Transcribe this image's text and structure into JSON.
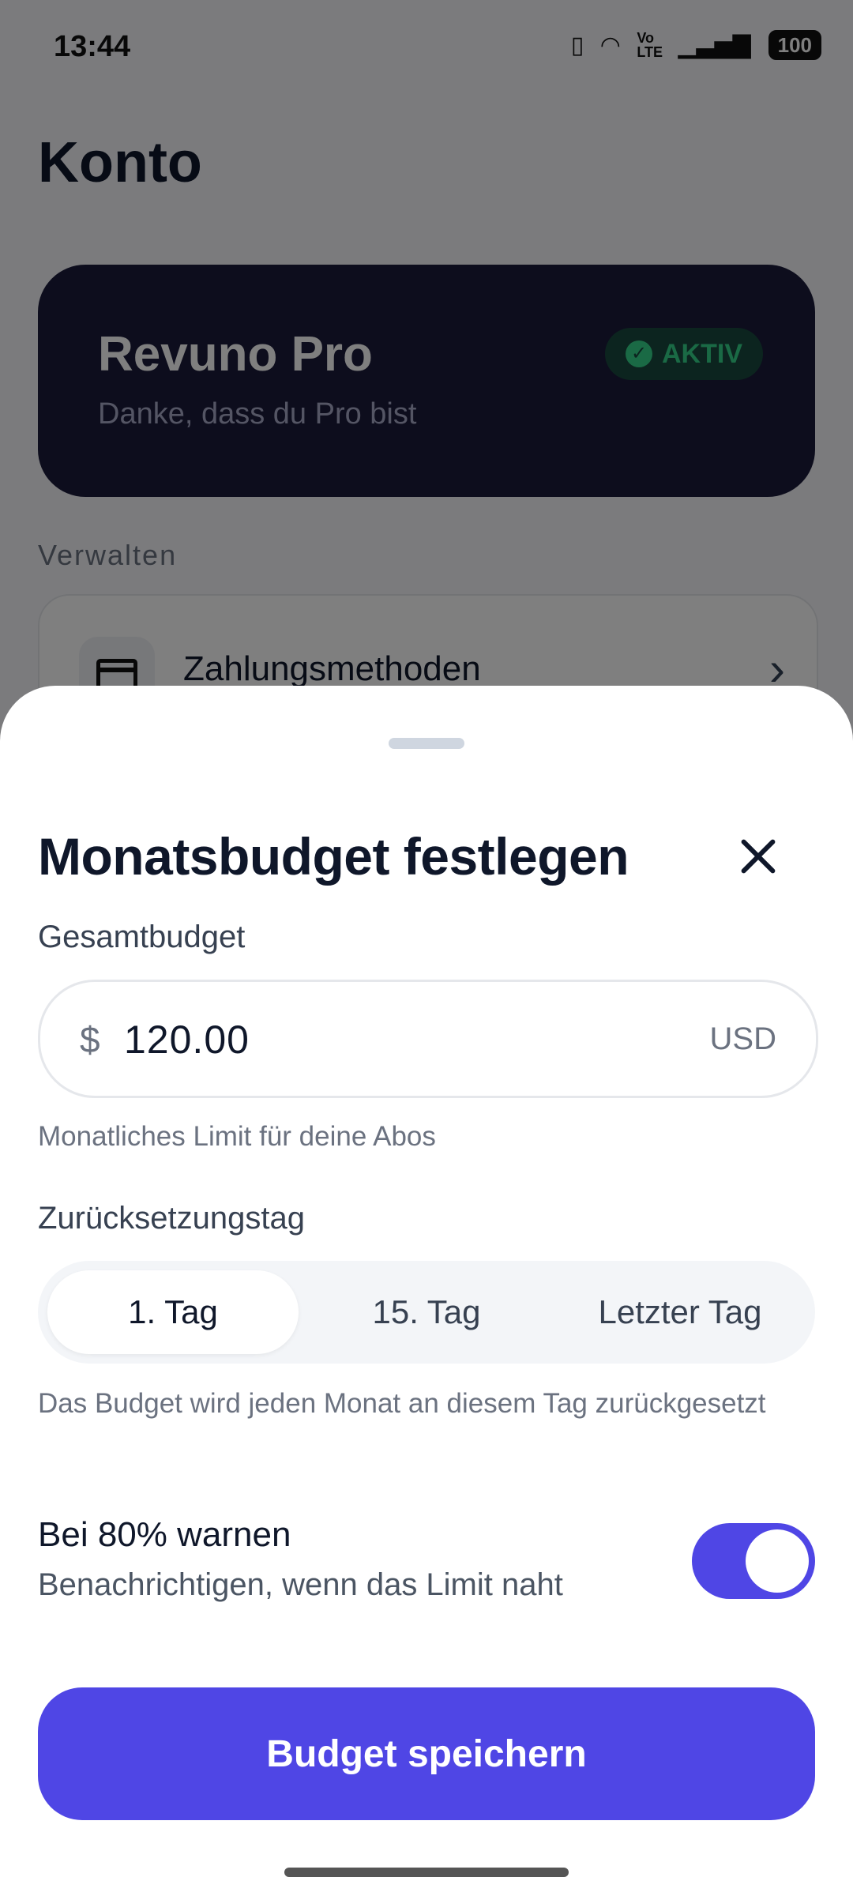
{
  "status_bar": {
    "time": "13:44",
    "battery": "100",
    "network": "Vo LTE"
  },
  "background": {
    "page_title": "Konto",
    "pro_card": {
      "title": "Revuno Pro",
      "subtitle": "Danke, dass du Pro bist",
      "badge": "AKTIV"
    },
    "section_label": "Verwalten",
    "list_items": [
      {
        "label": "Zahlungsmethoden"
      }
    ]
  },
  "sheet": {
    "title": "Monatsbudget festlegen",
    "budget": {
      "label": "Gesamtbudget",
      "currency_symbol": "$",
      "value": "120.00",
      "currency_code": "USD",
      "helper": "Monatliches Limit für deine Abos"
    },
    "reset_day": {
      "label": "Zurücksetzungstag",
      "options": [
        "1. Tag",
        "15. Tag",
        "Letzter Tag"
      ],
      "selected": "1. Tag",
      "helper": "Das Budget wird jeden Monat an diesem Tag zurückgesetzt"
    },
    "warning": {
      "title": "Bei 80% warnen",
      "subtitle": "Benachrichtigen, wenn das Limit naht",
      "enabled": true
    },
    "save_label": "Budget speichern"
  },
  "colors": {
    "accent": "#4f46e5",
    "success": "#35d48a",
    "card": "#1b1b3a"
  }
}
